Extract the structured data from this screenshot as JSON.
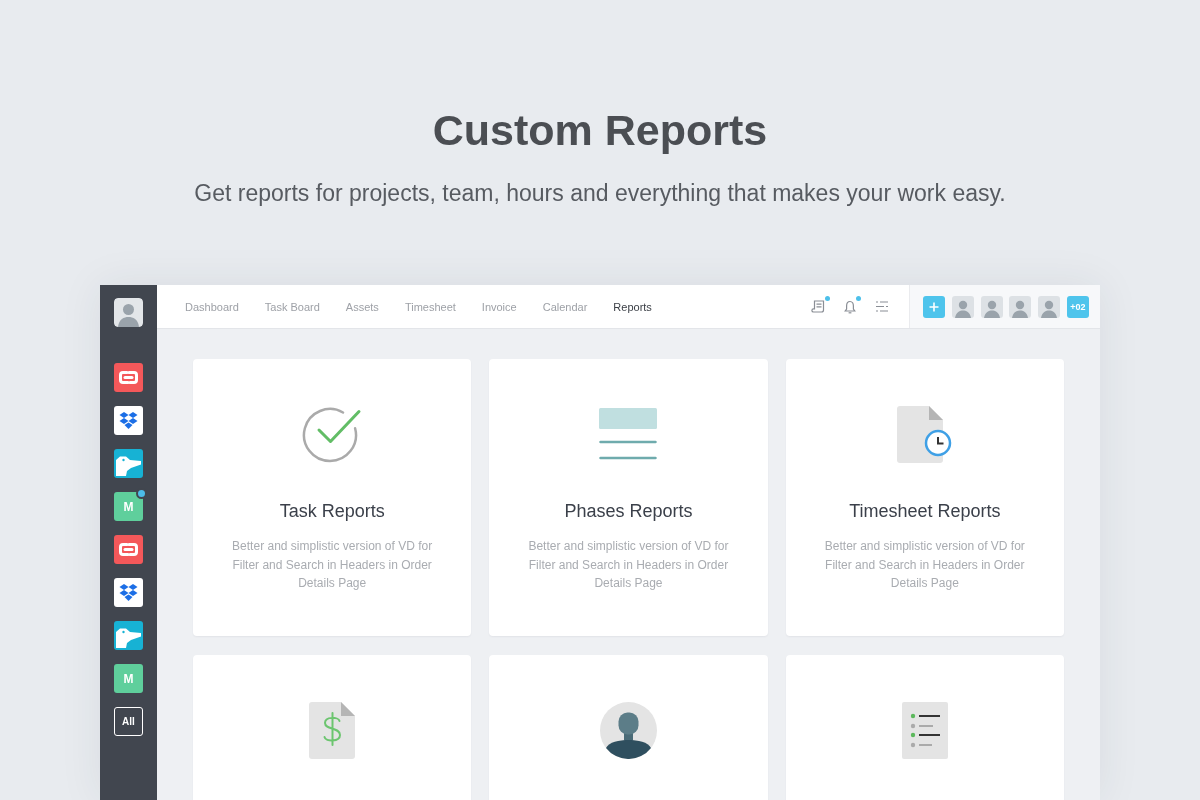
{
  "page": {
    "title": "Custom Reports",
    "subtitle": "Get reports for projects, team, hours and everything that makes your work easy."
  },
  "sidebar": {
    "apps": [
      {
        "kind": "swap",
        "badge": false
      },
      {
        "kind": "box",
        "badge": false
      },
      {
        "kind": "bird",
        "badge": false
      },
      {
        "kind": "letter",
        "letter": "M",
        "badge": true
      },
      {
        "kind": "swap",
        "badge": false
      },
      {
        "kind": "box",
        "badge": false
      },
      {
        "kind": "bird",
        "badge": false
      },
      {
        "kind": "letter",
        "letter": "M",
        "badge": false
      }
    ],
    "all_button": "All"
  },
  "nav": {
    "tabs": [
      {
        "label": "Dashboard",
        "selected": false
      },
      {
        "label": "Task Board",
        "selected": false
      },
      {
        "label": "Assets",
        "selected": false
      },
      {
        "label": "Timesheet",
        "selected": false
      },
      {
        "label": "Invoice",
        "selected": false
      },
      {
        "label": "Calendar",
        "selected": false
      },
      {
        "label": "Reports",
        "selected": true
      }
    ]
  },
  "toolbar": {
    "icons": [
      {
        "kind": "note",
        "dot": true
      },
      {
        "kind": "bell",
        "dot": true
      },
      {
        "kind": "sliders",
        "dot": false
      }
    ]
  },
  "team": {
    "more": "+02"
  },
  "cards": [
    {
      "kind": "check",
      "title": "Task Reports",
      "description": "Better and simplistic version of VD for Filter and Search in Headers in Order Details Page"
    },
    {
      "kind": "phases",
      "title": "Phases Reports",
      "description": "Better and simplistic version of VD for Filter and Search in Headers in Order Details Page"
    },
    {
      "kind": "timesheet",
      "title": "Timesheet Reports",
      "description": "Better and simplistic version of VD for Filter and Search in Headers in Order Details Page"
    },
    {
      "kind": "invoice"
    },
    {
      "kind": "user"
    },
    {
      "kind": "checklist"
    }
  ]
}
